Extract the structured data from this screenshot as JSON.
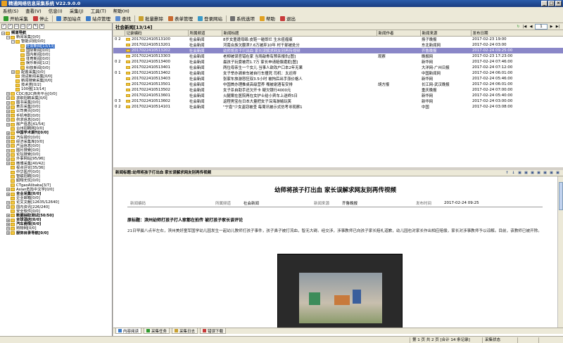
{
  "app": {
    "title": "精通网络信息采集系统 V22.9.0.0"
  },
  "window_buttons": [
    "_",
    "□",
    "×"
  ],
  "menu": [
    "系统(S)",
    "查看(V)",
    "信息(I)",
    "采集(J)",
    "工具(T)",
    "帮助(H)"
  ],
  "toolbar": [
    {
      "label": "开始采集",
      "icon": "play-icon",
      "color": "#2e9a2e"
    },
    {
      "label": "停止",
      "icon": "stop-icon",
      "color": "#c83a3a"
    },
    {
      "label": "添加站点",
      "icon": "add-site-icon",
      "color": "#3a7ac8"
    },
    {
      "label": "站点管理",
      "icon": "site-manage-icon",
      "color": "#3a7ac8"
    },
    {
      "label": "查找",
      "icon": "search-icon",
      "color": "#5a8ad0"
    },
    {
      "label": "批量删除",
      "icon": "batch-delete-icon",
      "color": "#c8a030"
    },
    {
      "label": "表单管理",
      "icon": "form-manage-icon",
      "color": "#c86a30"
    },
    {
      "label": "登录网站",
      "icon": "login-icon",
      "color": "#3a9ac8"
    },
    {
      "label": "系统选项",
      "icon": "options-icon",
      "color": "#707070"
    },
    {
      "label": "帮助",
      "icon": "help-icon",
      "color": "#e0a020"
    },
    {
      "label": "退出",
      "icon": "exit-icon",
      "color": "#c83a3a"
    }
  ],
  "left_tools": [
    "✓",
    "✓",
    "▭",
    "▭",
    "✓",
    "✎",
    "✕"
  ],
  "tree": [
    {
      "label": "频道导航",
      "level": 0,
      "exp": "−",
      "bold": true
    },
    {
      "label": "新闻采集[0/0]",
      "level": 1,
      "exp": "−"
    },
    {
      "label": "智能识别[0/0]",
      "level": 2,
      "exp": "−"
    },
    {
      "label": "社会新闻[13/13]",
      "level": 3,
      "selected": true
    },
    {
      "label": "国际新闻[0/0]",
      "level": 3
    },
    {
      "label": "国内新闻[0/0]",
      "level": 3
    },
    {
      "label": "体育新闻[0/0]",
      "level": 3
    },
    {
      "label": "娱乐新闻[1/2]",
      "level": 3
    },
    {
      "label": "科技新闻[0/0]",
      "level": 3
    },
    {
      "label": "配置采集[0/0]",
      "level": 2,
      "exp": "+"
    },
    {
      "label": "测试新闻采集[0/0]",
      "level": 2
    },
    {
      "label": "新闻搜索采集[0/0]",
      "level": 2
    },
    {
      "label": "技术类[0/2]",
      "level": 2
    },
    {
      "label": "100强[13/14]",
      "level": 2
    },
    {
      "label": "CDC/B2C商务平台[0/0]",
      "level": 1,
      "exp": "+"
    },
    {
      "label": "求职招聘采集[0/0]",
      "level": 1,
      "exp": "+"
    },
    {
      "label": "图书采集[0/0]",
      "level": 1,
      "exp": "+"
    },
    {
      "label": "黄页采集[0/0]",
      "level": 1,
      "exp": "+"
    },
    {
      "label": "公司黄页[0/0]",
      "level": 1,
      "exp": "+"
    },
    {
      "label": "手机电影[0/0]",
      "level": 1,
      "exp": "+"
    },
    {
      "label": "供求信息[0/0]",
      "level": 1,
      "exp": "+"
    },
    {
      "label": "房产信息[41/54]",
      "level": 1,
      "exp": "+"
    },
    {
      "label": "台州招聘网[0/0]",
      "level": 1
    },
    {
      "label": "中国学术期刊[0/0]",
      "level": 1,
      "exp": "+",
      "bold": true
    },
    {
      "label": "汽车报价[0/0]",
      "level": 1,
      "exp": "+"
    },
    {
      "label": "经济采集库[0/0]",
      "level": 1,
      "exp": "+"
    },
    {
      "label": "产品信息[0/0]",
      "level": 1,
      "exp": "+"
    },
    {
      "label": "图片搜索[0/0]",
      "level": 1,
      "exp": "+"
    },
    {
      "label": "论坛搜索[0/0]",
      "level": 1,
      "exp": "+"
    },
    {
      "label": "外事网站[95/96]",
      "level": 1,
      "exp": "+"
    },
    {
      "label": "微博采集[40/42]",
      "level": 1,
      "exp": "+"
    },
    {
      "label": "视点评论[35/36]",
      "level": 1
    },
    {
      "label": "中华医疗[0/0]",
      "level": 1
    },
    {
      "label": "智联招聘[0/0]",
      "level": 1
    },
    {
      "label": "韶翔无忧[0/0]",
      "level": 1
    },
    {
      "label": "CTgaoAlibaba[3/7]",
      "level": 1
    },
    {
      "label": "Aslan危险中文学[0/0]",
      "level": 1,
      "exp": "+"
    },
    {
      "label": "全业采集[0/0]",
      "level": 1,
      "exp": "+",
      "bold": true
    },
    {
      "label": "企业邮箱[0/0]",
      "level": 1
    },
    {
      "label": "论文文献[12635/12640]",
      "level": 1,
      "exp": "+"
    },
    {
      "label": "国内资讯[226/240]",
      "level": 1,
      "exp": "+"
    },
    {
      "label": "安全软件[0/0]",
      "level": 1
    },
    {
      "label": "数据抽取测试[50/50]",
      "level": 1,
      "exp": "+",
      "bold": true
    },
    {
      "label": "全球酒店[0/0]",
      "level": 1,
      "exp": "+",
      "bold": true
    },
    {
      "label": "汽车商情[0/0]",
      "level": 1,
      "exp": "+",
      "bold": true
    },
    {
      "label": "购物网[0/0]",
      "level": 1,
      "exp": "+"
    },
    {
      "label": "服饰目录导航[0/0]",
      "level": 1,
      "exp": "+",
      "bold": true
    }
  ],
  "list": {
    "title": "社会新闻[13/14]",
    "page": "1",
    "columns": [
      "",
      "记录编码",
      "所属频道",
      "新闻标题",
      "新闻作者",
      "新闻来源",
      "发布日期"
    ],
    "rows": [
      {
        "mark": "0 2",
        "id": "2017022410513100",
        "channel": "社会新闻",
        "title": "8岁女童遭母殴:皮鞋一碰即烂 生水痘瘤痕",
        "author": "",
        "source": "扬子晚报",
        "date": "2017-02-23 19:00"
      },
      {
        "mark": "",
        "id": "2017022410513201",
        "channel": "社会新闻",
        "title": "河南合族欠额泄7.6万被弃10年 村干部被处分",
        "author": "",
        "source": "东北新闻网",
        "date": "2017-02-24 03:00"
      },
      {
        "mark": "",
        "id": "2017022410513202",
        "channel": "社会新闻",
        "title": "幼师将孩子打出血 家长误解求网友别再传视频",
        "author": "",
        "source": "齐鲁晚报",
        "date": "2017-02-24 09:25:00",
        "selected": true
      },
      {
        "mark": "",
        "id": "2017022410513303",
        "channel": "社会新闻",
        "title": "老柳被误官错在家 当场敲骨有预亲报仇[图]",
        "author": "观察",
        "source": "晚报网",
        "date": "2017-02-23 17:23:00"
      },
      {
        "mark": "0 2",
        "id": "2017022410513400",
        "channel": "社会新闻",
        "title": "最孩子玩耍被罚1.7万 家长申请赔偿遭拒[图]",
        "author": "",
        "source": "新华网",
        "date": "2017-02-24 07:46:00"
      },
      {
        "mark": "",
        "id": "2017022410513401",
        "channel": "社会新闻",
        "title": "两位母亲生一个女儿 当事人欲改户口本2年无果",
        "author": "",
        "source": "大洋网-广州日报",
        "date": "2017-02-24 07:12:00"
      },
      {
        "mark": "0 1",
        "id": "2017022410513402",
        "channel": "社会新闻",
        "title": "女子举办骑单车被自行车撞死 司机：太迟得",
        "author": "",
        "source": "中国新闻网",
        "date": "2017-02-24 06:01:00"
      },
      {
        "mark": "",
        "id": "2017022410513403",
        "channel": "社会新闻",
        "title": "张家车旅游怒狂双3.5小时 被拘后出手涨价格人",
        "author": "",
        "source": "新华网",
        "date": "2017-02-24 05:46:00"
      },
      {
        "mark": "",
        "id": "2017022410513501",
        "channel": "社会新闻",
        "title": "中国首办理推桌高级营养 嘴被谢酒有安排",
        "author": "胡方报",
        "source": "长江网-武汉晚报",
        "date": "2017-02-24 06:01:00"
      },
      {
        "mark": "",
        "id": "2017022410513502",
        "channel": "社会新闻",
        "title": "女子杀自助手还欠开卡 疑欠银行4000元",
        "author": "",
        "source": "重庆晚报",
        "date": "2017-02-24 07:00:00"
      },
      {
        "mark": "",
        "id": "2017022410513601",
        "channel": "社会新闻",
        "title": "火腿案在医院再在女护士给小宾车上送终5日",
        "author": "",
        "source": "新华网",
        "date": "2017-02-24 05:40:00"
      },
      {
        "mark": "0 3",
        "id": "2017022410513602",
        "channel": "社会新闻",
        "title": "返程男宝在日本大量把女子深海游嬉玩笑",
        "author": "",
        "source": "新华网",
        "date": "2017-02-24 03:00:00"
      },
      {
        "mark": "0 2",
        "id": "2017022410514101",
        "channel": "社会新闻",
        "title": "\"宁嘉\"少女盗窃被查 每周讯被示式仿考寻现察1",
        "author": "",
        "source": "中国",
        "date": "2017-02-24 03:08:00"
      }
    ]
  },
  "detail": {
    "header": "新闻标题:幼师将孩子打出血 家长误解求网友别再传视频",
    "tools": [
      "↑",
      "↓",
      "▣",
      "▣",
      "▣",
      "▣",
      "▣",
      "▣",
      "▣"
    ],
    "title": "幼师将孩子打出血 家长误解求网友别再传视频",
    "meta": [
      {
        "label": "新闻编码",
        "value": ""
      },
      {
        "label": "所属频道",
        "value": "社会新闻"
      },
      {
        "label": "新闻来源",
        "value": "齐鲁晚报"
      },
      {
        "label": "发布时间",
        "value": "2017-02-24 09:25"
      }
    ],
    "lead": "原标题：滨州幼师打孩子打人家都在拍传 被打孩子家长谈评论",
    "paragraph": "21日早晨八点半左右，滨州美好童军国学幼儿园发生一起幼儿教师打孩子事件，孩子鼻子被打流血，智无大碍。经交涉，涉事教师已向孩子家长赔礼道歉，幼儿园也对家长作出相应赔偿，家长对涉事教师予以谅解。目前，该教师已被开除。"
  },
  "bottom_tabs": [
    {
      "label": "内容阅读",
      "icon": "read-icon",
      "color": "#3a7ac8",
      "active": true
    },
    {
      "label": "采集任务",
      "icon": "task-icon",
      "color": "#2e9a2e"
    },
    {
      "label": "采集日志",
      "icon": "log-icon",
      "color": "#c8a030"
    },
    {
      "label": "错误下载",
      "icon": "error-download-icon",
      "color": "#c83a3a"
    }
  ],
  "status": {
    "page_info": "第 1 页 共 2 页 [合计 14 条记录]",
    "collect_status": "采集状态"
  }
}
